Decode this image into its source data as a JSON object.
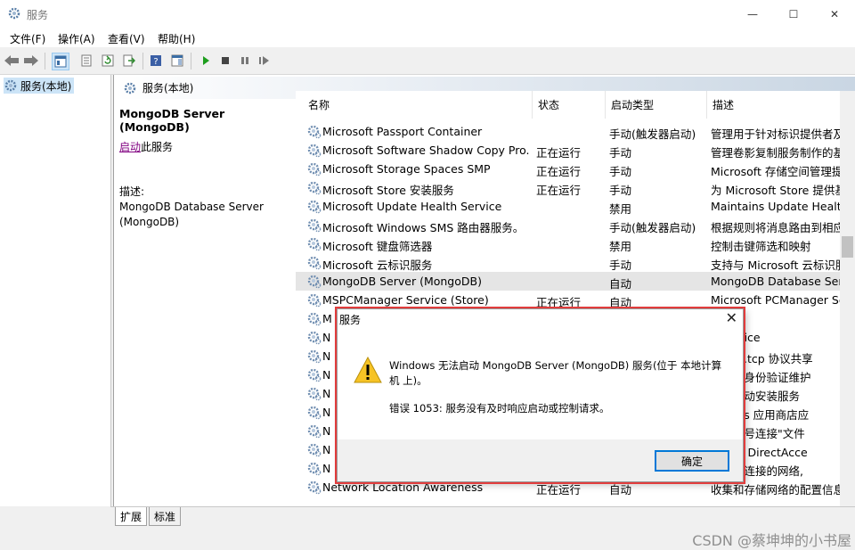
{
  "window": {
    "title": "服务",
    "minimize": "—",
    "maximize": "☐",
    "close": "✕"
  },
  "menu": [
    "文件(F)",
    "操作(A)",
    "查看(V)",
    "帮助(H)"
  ],
  "tree": {
    "item": "服务(本地)"
  },
  "panel": {
    "header": "服务(本地)"
  },
  "description": {
    "service_title": "MongoDB Server (MongoDB)",
    "start_link": "启动",
    "start_suffix": "此服务",
    "label": "描述:",
    "text": "MongoDB Database Server (MongoDB)"
  },
  "columns": [
    "名称",
    "状态",
    "启动类型",
    "描述"
  ],
  "rows": [
    {
      "name": "Microsoft Passport Container",
      "status": "",
      "type": "手动(触发器启动)",
      "desc": "管理用于针对标识提供者及"
    },
    {
      "name": "Microsoft Software Shadow Copy Pro...",
      "status": "正在运行",
      "type": "手动",
      "desc": "管理卷影复制服务制作的基"
    },
    {
      "name": "Microsoft Storage Spaces SMP",
      "status": "正在运行",
      "type": "手动",
      "desc": "Microsoft 存储空间管理提"
    },
    {
      "name": "Microsoft Store 安装服务",
      "status": "正在运行",
      "type": "手动",
      "desc": "为 Microsoft Store 提供基"
    },
    {
      "name": "Microsoft Update Health Service",
      "status": "",
      "type": "禁用",
      "desc": "Maintains Update Health"
    },
    {
      "name": "Microsoft Windows SMS 路由器服务。",
      "status": "",
      "type": "手动(触发器启动)",
      "desc": "根据规则将消息路由到相应"
    },
    {
      "name": "Microsoft 键盘筛选器",
      "status": "",
      "type": "禁用",
      "desc": "控制击键筛选和映射"
    },
    {
      "name": "Microsoft 云标识服务",
      "status": "",
      "type": "手动",
      "desc": "支持与 Microsoft 云标识服"
    },
    {
      "name": "MongoDB Server (MongoDB)",
      "status": "",
      "type": "自动",
      "desc": "MongoDB Database Ser"
    },
    {
      "name": "MSPCManager Service (Store)",
      "status": "正在运行",
      "type": "自动",
      "desc": "Microsoft PCManager Se"
    },
    {
      "name": "M",
      "status": "",
      "type": "",
      "desc": ""
    },
    {
      "name": "N",
      "status": "",
      "type": "",
      "desc": "c service"
    },
    {
      "name": "N",
      "status": "",
      "type": "",
      "desc": "过 net.tcp 协议共享"
    },
    {
      "name": "N",
      "status": "",
      "type": "",
      "desc": "和服务身份验证维护"
    },
    {
      "name": "N",
      "status": "",
      "type": "",
      "desc": "设备自动安装服务"
    },
    {
      "name": "N",
      "status": "",
      "type": "",
      "desc": "indows 应用商店应"
    },
    {
      "name": "N",
      "status": "",
      "type": "",
      "desc": "络和拨号连接\"文件"
    },
    {
      "name": "N",
      "status": "",
      "type": "",
      "desc": "组件的 DirectAcce"
    },
    {
      "name": "N",
      "status": "",
      "type": "",
      "desc": "算机已连接的网络,"
    },
    {
      "name": "Network Location Awareness",
      "status": "正在运行",
      "type": "自动",
      "desc": "收集和存储网络的配置信息"
    }
  ],
  "tabs": [
    "扩展",
    "标准"
  ],
  "dialog": {
    "title": "服务",
    "message": "Windows 无法启动 MongoDB Server (MongoDB) 服务(位于 本地计算机 上)。",
    "error": "错误 1053: 服务没有及时响应启动或控制请求。",
    "ok": "确定"
  },
  "watermark": "CSDN @蔡坤坤的小书屋",
  "colors": {
    "highlight_frame": "#e23c3c",
    "focus_border": "#0078d7",
    "selection": "#e5e5e5"
  }
}
